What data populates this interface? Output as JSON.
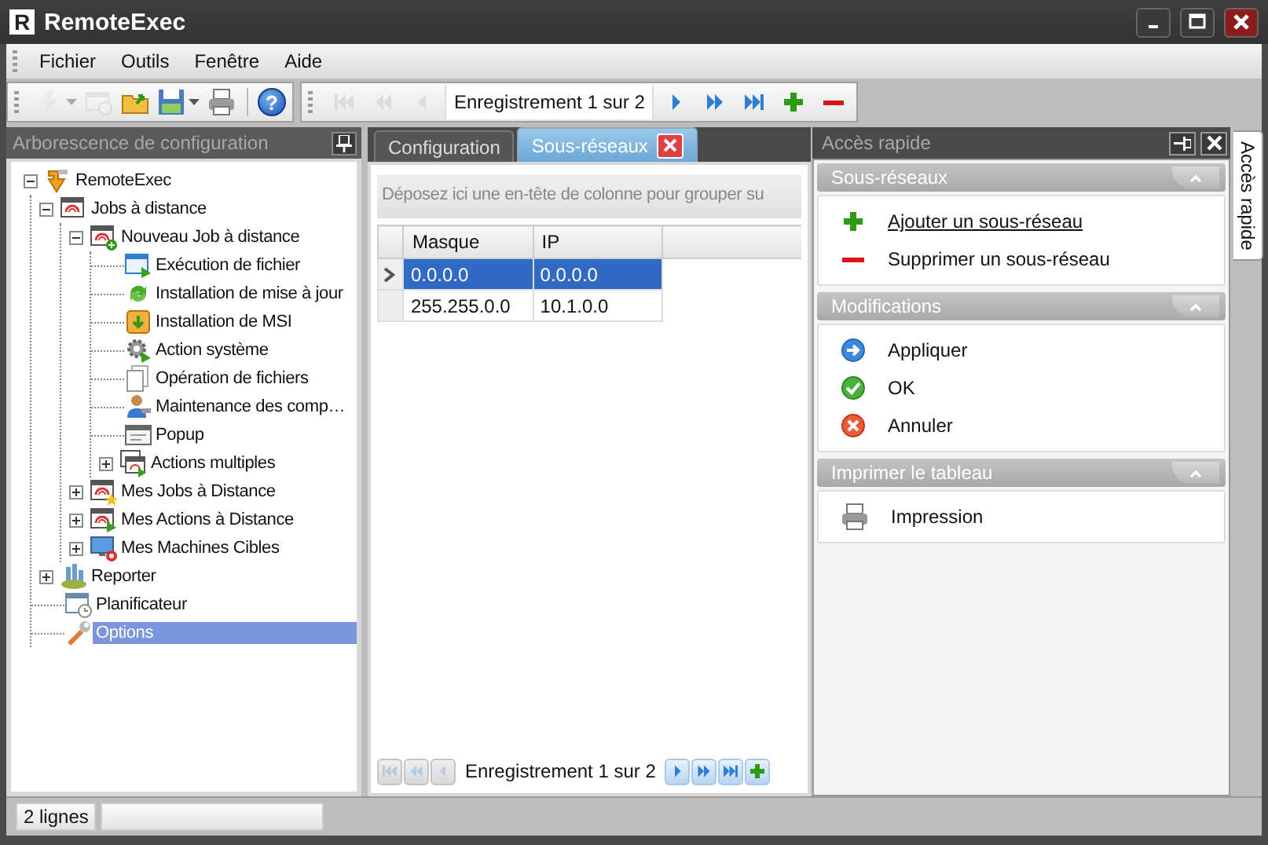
{
  "window": {
    "logo": "R",
    "title": "RemoteExec"
  },
  "menu": [
    "Fichier",
    "Outils",
    "Fenêtre",
    "Aide"
  ],
  "toolbar": [
    {
      "kind": "run",
      "disabled": true,
      "dropdown": true
    },
    {
      "kind": "schedule",
      "disabled": true
    },
    {
      "kind": "open",
      "disabled": false
    },
    {
      "kind": "save",
      "disabled": false,
      "dropdown": true
    },
    {
      "kind": "print",
      "disabled": false
    },
    {
      "kind": "help",
      "disabled": false,
      "glyph": "?"
    }
  ],
  "navigator": {
    "before": [
      {
        "kind": "first",
        "disabled": true
      },
      {
        "kind": "prevpage",
        "disabled": true
      },
      {
        "kind": "prev",
        "disabled": true
      }
    ],
    "record": "Enregistrement 1 sur 2",
    "after": [
      {
        "kind": "next",
        "disabled": false
      },
      {
        "kind": "nextpage",
        "disabled": false
      },
      {
        "kind": "last",
        "disabled": false
      },
      {
        "kind": "add",
        "disabled": false
      },
      {
        "kind": "remove",
        "disabled": false
      }
    ]
  },
  "tree_panel": {
    "title": "Arborescence de configuration",
    "nodes": [
      {
        "label": "RemoteExec",
        "kind": "app",
        "expanded": true,
        "selected": false,
        "children": [
          {
            "label": "Jobs à distance",
            "kind": "jobs",
            "expanded": true,
            "selected": false,
            "children": [
              {
                "label": "Nouveau Job à distance",
                "kind": "newjob",
                "expanded": true,
                "selected": false,
                "children": [
                  {
                    "label": "Exécution de fichier",
                    "kind": "exec",
                    "selected": false
                  },
                  {
                    "label": "Installation de mise à jour",
                    "kind": "update",
                    "selected": false
                  },
                  {
                    "label": "Installation de MSI",
                    "kind": "msi",
                    "selected": false
                  },
                  {
                    "label": "Action système",
                    "kind": "gear",
                    "selected": false
                  },
                  {
                    "label": "Opération de fichiers",
                    "kind": "files",
                    "selected": false
                  },
                  {
                    "label": "Maintenance des comp…",
                    "kind": "person",
                    "selected": false
                  },
                  {
                    "label": "Popup",
                    "kind": "popup",
                    "selected": false
                  },
                  {
                    "label": "Actions multiples",
                    "kind": "multi",
                    "expanded": false,
                    "selected": false
                  }
                ]
              },
              {
                "label": "Mes Jobs à Distance",
                "kind": "fav",
                "expanded": false,
                "selected": false
              },
              {
                "label": "Mes Actions à Distance",
                "kind": "actions",
                "expanded": false,
                "selected": false
              },
              {
                "label": "Mes Machines Cibles",
                "kind": "machines",
                "expanded": false,
                "selected": false
              }
            ]
          },
          {
            "label": "Reporter",
            "kind": "reporter",
            "expanded": false,
            "selected": false
          },
          {
            "label": "Planificateur",
            "kind": "scheduler",
            "selected": false
          },
          {
            "label": "Options",
            "kind": "options",
            "selected": true
          }
        ]
      }
    ]
  },
  "document_tabs": [
    {
      "label": "Configuration",
      "selected": false,
      "closable": false
    },
    {
      "label": "Sous-réseaux",
      "selected": true,
      "closable": true
    }
  ],
  "grid": {
    "group_hint": "Déposez ici une en-tête de colonne pour grouper su",
    "columns": [
      "Masque",
      "IP"
    ],
    "rows": [
      {
        "cells": [
          "0.0.0.0",
          "0.0.0.0"
        ],
        "selected": true
      },
      {
        "cells": [
          "255.255.0.0",
          "10.1.0.0"
        ],
        "selected": false
      }
    ],
    "pager": {
      "before": [
        {
          "kind": "first",
          "disabled": true
        },
        {
          "kind": "prevpage",
          "disabled": true
        },
        {
          "kind": "prev",
          "disabled": true
        }
      ],
      "record": "Enregistrement 1 sur 2",
      "after": [
        {
          "kind": "next",
          "disabled": false
        },
        {
          "kind": "nextpage",
          "disabled": false
        },
        {
          "kind": "last",
          "disabled": false
        },
        {
          "kind": "add",
          "disabled": false
        }
      ]
    }
  },
  "quick_access": {
    "title": "Accès rapide",
    "groups": [
      {
        "title": "Sous-réseaux",
        "expanded": true,
        "items": [
          {
            "kind": "add",
            "label": "Ajouter un sous-réseau",
            "hovered": true
          },
          {
            "kind": "remove",
            "label": "Supprimer un sous-réseau",
            "hovered": false
          }
        ]
      },
      {
        "title": "Modifications",
        "expanded": true,
        "items": [
          {
            "kind": "apply",
            "label": "Appliquer",
            "hovered": false
          },
          {
            "kind": "ok",
            "label": "OK",
            "hovered": false
          },
          {
            "kind": "cancel",
            "label": "Annuler",
            "hovered": false
          }
        ]
      },
      {
        "title": "Imprimer le tableau",
        "expanded": true,
        "items": [
          {
            "kind": "print",
            "label": "Impression",
            "hovered": false
          }
        ]
      }
    ]
  },
  "side_tab": {
    "label": "Accès rapide"
  },
  "status_bar": [
    "2 lignes"
  ]
}
